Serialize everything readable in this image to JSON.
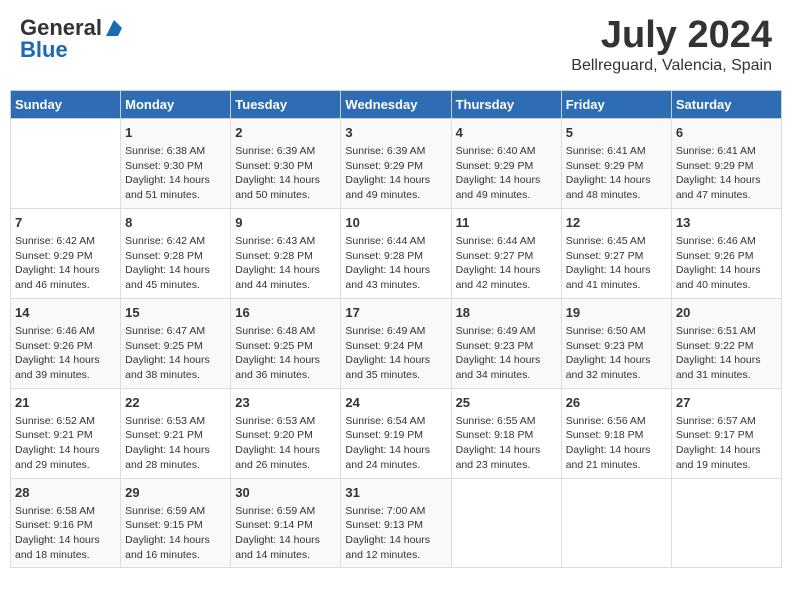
{
  "logo": {
    "general": "General",
    "blue": "Blue"
  },
  "header": {
    "month": "July 2024",
    "location": "Bellreguard, Valencia, Spain"
  },
  "days_of_week": [
    "Sunday",
    "Monday",
    "Tuesday",
    "Wednesday",
    "Thursday",
    "Friday",
    "Saturday"
  ],
  "weeks": [
    [
      {
        "day": "",
        "sunrise": "",
        "sunset": "",
        "daylight": ""
      },
      {
        "day": "1",
        "sunrise": "Sunrise: 6:38 AM",
        "sunset": "Sunset: 9:30 PM",
        "daylight": "Daylight: 14 hours and 51 minutes."
      },
      {
        "day": "2",
        "sunrise": "Sunrise: 6:39 AM",
        "sunset": "Sunset: 9:30 PM",
        "daylight": "Daylight: 14 hours and 50 minutes."
      },
      {
        "day": "3",
        "sunrise": "Sunrise: 6:39 AM",
        "sunset": "Sunset: 9:29 PM",
        "daylight": "Daylight: 14 hours and 49 minutes."
      },
      {
        "day": "4",
        "sunrise": "Sunrise: 6:40 AM",
        "sunset": "Sunset: 9:29 PM",
        "daylight": "Daylight: 14 hours and 49 minutes."
      },
      {
        "day": "5",
        "sunrise": "Sunrise: 6:41 AM",
        "sunset": "Sunset: 9:29 PM",
        "daylight": "Daylight: 14 hours and 48 minutes."
      },
      {
        "day": "6",
        "sunrise": "Sunrise: 6:41 AM",
        "sunset": "Sunset: 9:29 PM",
        "daylight": "Daylight: 14 hours and 47 minutes."
      }
    ],
    [
      {
        "day": "7",
        "sunrise": "Sunrise: 6:42 AM",
        "sunset": "Sunset: 9:29 PM",
        "daylight": "Daylight: 14 hours and 46 minutes."
      },
      {
        "day": "8",
        "sunrise": "Sunrise: 6:42 AM",
        "sunset": "Sunset: 9:28 PM",
        "daylight": "Daylight: 14 hours and 45 minutes."
      },
      {
        "day": "9",
        "sunrise": "Sunrise: 6:43 AM",
        "sunset": "Sunset: 9:28 PM",
        "daylight": "Daylight: 14 hours and 44 minutes."
      },
      {
        "day": "10",
        "sunrise": "Sunrise: 6:44 AM",
        "sunset": "Sunset: 9:28 PM",
        "daylight": "Daylight: 14 hours and 43 minutes."
      },
      {
        "day": "11",
        "sunrise": "Sunrise: 6:44 AM",
        "sunset": "Sunset: 9:27 PM",
        "daylight": "Daylight: 14 hours and 42 minutes."
      },
      {
        "day": "12",
        "sunrise": "Sunrise: 6:45 AM",
        "sunset": "Sunset: 9:27 PM",
        "daylight": "Daylight: 14 hours and 41 minutes."
      },
      {
        "day": "13",
        "sunrise": "Sunrise: 6:46 AM",
        "sunset": "Sunset: 9:26 PM",
        "daylight": "Daylight: 14 hours and 40 minutes."
      }
    ],
    [
      {
        "day": "14",
        "sunrise": "Sunrise: 6:46 AM",
        "sunset": "Sunset: 9:26 PM",
        "daylight": "Daylight: 14 hours and 39 minutes."
      },
      {
        "day": "15",
        "sunrise": "Sunrise: 6:47 AM",
        "sunset": "Sunset: 9:25 PM",
        "daylight": "Daylight: 14 hours and 38 minutes."
      },
      {
        "day": "16",
        "sunrise": "Sunrise: 6:48 AM",
        "sunset": "Sunset: 9:25 PM",
        "daylight": "Daylight: 14 hours and 36 minutes."
      },
      {
        "day": "17",
        "sunrise": "Sunrise: 6:49 AM",
        "sunset": "Sunset: 9:24 PM",
        "daylight": "Daylight: 14 hours and 35 minutes."
      },
      {
        "day": "18",
        "sunrise": "Sunrise: 6:49 AM",
        "sunset": "Sunset: 9:23 PM",
        "daylight": "Daylight: 14 hours and 34 minutes."
      },
      {
        "day": "19",
        "sunrise": "Sunrise: 6:50 AM",
        "sunset": "Sunset: 9:23 PM",
        "daylight": "Daylight: 14 hours and 32 minutes."
      },
      {
        "day": "20",
        "sunrise": "Sunrise: 6:51 AM",
        "sunset": "Sunset: 9:22 PM",
        "daylight": "Daylight: 14 hours and 31 minutes."
      }
    ],
    [
      {
        "day": "21",
        "sunrise": "Sunrise: 6:52 AM",
        "sunset": "Sunset: 9:21 PM",
        "daylight": "Daylight: 14 hours and 29 minutes."
      },
      {
        "day": "22",
        "sunrise": "Sunrise: 6:53 AM",
        "sunset": "Sunset: 9:21 PM",
        "daylight": "Daylight: 14 hours and 28 minutes."
      },
      {
        "day": "23",
        "sunrise": "Sunrise: 6:53 AM",
        "sunset": "Sunset: 9:20 PM",
        "daylight": "Daylight: 14 hours and 26 minutes."
      },
      {
        "day": "24",
        "sunrise": "Sunrise: 6:54 AM",
        "sunset": "Sunset: 9:19 PM",
        "daylight": "Daylight: 14 hours and 24 minutes."
      },
      {
        "day": "25",
        "sunrise": "Sunrise: 6:55 AM",
        "sunset": "Sunset: 9:18 PM",
        "daylight": "Daylight: 14 hours and 23 minutes."
      },
      {
        "day": "26",
        "sunrise": "Sunrise: 6:56 AM",
        "sunset": "Sunset: 9:18 PM",
        "daylight": "Daylight: 14 hours and 21 minutes."
      },
      {
        "day": "27",
        "sunrise": "Sunrise: 6:57 AM",
        "sunset": "Sunset: 9:17 PM",
        "daylight": "Daylight: 14 hours and 19 minutes."
      }
    ],
    [
      {
        "day": "28",
        "sunrise": "Sunrise: 6:58 AM",
        "sunset": "Sunset: 9:16 PM",
        "daylight": "Daylight: 14 hours and 18 minutes."
      },
      {
        "day": "29",
        "sunrise": "Sunrise: 6:59 AM",
        "sunset": "Sunset: 9:15 PM",
        "daylight": "Daylight: 14 hours and 16 minutes."
      },
      {
        "day": "30",
        "sunrise": "Sunrise: 6:59 AM",
        "sunset": "Sunset: 9:14 PM",
        "daylight": "Daylight: 14 hours and 14 minutes."
      },
      {
        "day": "31",
        "sunrise": "Sunrise: 7:00 AM",
        "sunset": "Sunset: 9:13 PM",
        "daylight": "Daylight: 14 hours and 12 minutes."
      },
      {
        "day": "",
        "sunrise": "",
        "sunset": "",
        "daylight": ""
      },
      {
        "day": "",
        "sunrise": "",
        "sunset": "",
        "daylight": ""
      },
      {
        "day": "",
        "sunrise": "",
        "sunset": "",
        "daylight": ""
      }
    ]
  ]
}
